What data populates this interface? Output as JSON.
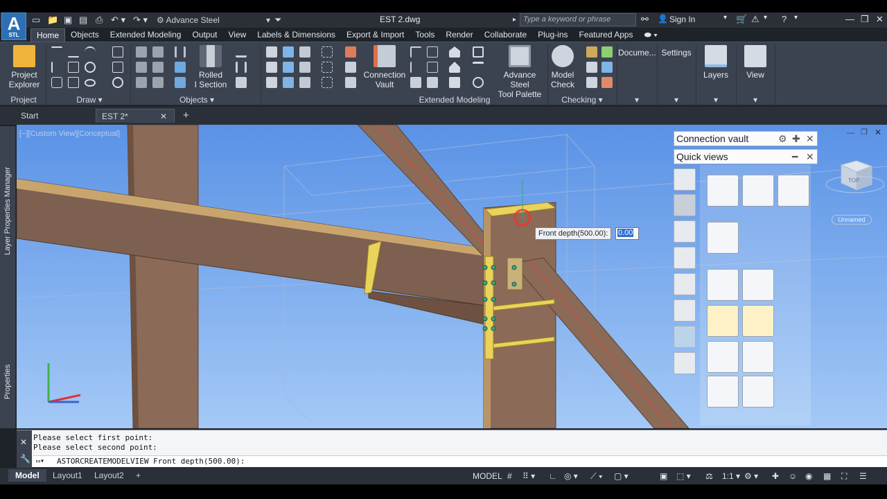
{
  "app": {
    "logo_text": "A",
    "logo_sub": "STL",
    "workspace": "Advance Steel",
    "document_title": "EST 2.dwg",
    "search_placeholder": "Type a keyword or phrase",
    "sign_in": "Sign In"
  },
  "ribbon": {
    "tabs": [
      {
        "label": "Home",
        "active": true
      },
      {
        "label": "Objects"
      },
      {
        "label": "Extended Modeling"
      },
      {
        "label": "Output"
      },
      {
        "label": "View"
      },
      {
        "label": "Labels & Dimensions"
      },
      {
        "label": "Export & Import"
      },
      {
        "label": "Tools"
      },
      {
        "label": "Render"
      },
      {
        "label": "Collaborate"
      },
      {
        "label": "Plug-ins"
      },
      {
        "label": "Featured Apps"
      }
    ],
    "buttons": {
      "project_explorer": "Project\nExplorer",
      "rolled_section": "Rolled\nI Section",
      "connection_vault": "Connection\nVault",
      "tool_palette": "Advance Steel\nTool Palette",
      "model_check": "Model\nCheck",
      "documents": "Docume...",
      "settings": "Settings",
      "layers": "Layers",
      "view": "View"
    },
    "panels": {
      "project": "Project",
      "draw": "Draw",
      "objects": "Objects",
      "extended": "Extended Modeling",
      "checking": "Checking"
    }
  },
  "doc_tabs": [
    {
      "label": "Start"
    },
    {
      "label": "EST 2*",
      "active": true
    }
  ],
  "side_palettes": {
    "layer_manager": "Layer Properties Manager",
    "properties": "Properties"
  },
  "viewport": {
    "view_label": "[−][Custom View][Conceptual]",
    "viewcube_top": "TOP",
    "viewcube_ucs": "Unnamed"
  },
  "dynamic_input": {
    "prompt": "Front depth(500.00):",
    "value": "0.00"
  },
  "vault": {
    "title": "Connection vault",
    "subtitle": "Quick views"
  },
  "command_line": {
    "history": [
      "Please select first point:",
      "Please select second point:"
    ],
    "current": "ASTORCREATEMODELVIEW Front depth(500.00):"
  },
  "status": {
    "layouts": [
      {
        "label": "Model",
        "active": true
      },
      {
        "label": "Layout1"
      },
      {
        "label": "Layout2"
      }
    ],
    "model_label": "MODEL",
    "scale": "1:1"
  },
  "colors": {
    "accent": "#2d6fb5",
    "steel": "#8b6a57",
    "steel_dark": "#6e5140",
    "plate": "#e9d35a",
    "sky_top": "#5a92e6",
    "sky_bottom": "#9fc6f5"
  }
}
